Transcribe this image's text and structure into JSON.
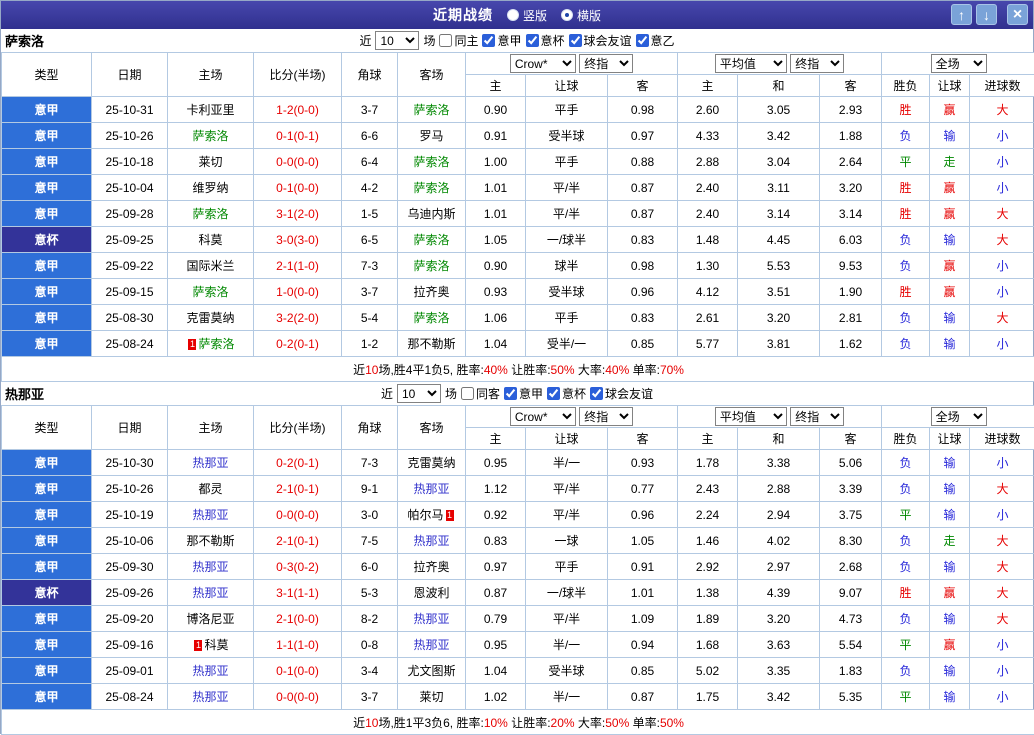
{
  "colors": {
    "titlebar_from": "#4747ad",
    "titlebar_to": "#30308e",
    "button_bg": "#7aa3d8",
    "grid_line": "#b3c9e2",
    "league_bg": "#2e6fd8",
    "cup_bg": "#333399",
    "score_red": "#e60000",
    "result_red": "#e60000",
    "result_green": "#008800",
    "result_blue": "#2626d9"
  },
  "titlebar": {
    "title": "近期战绩",
    "layout_options": [
      {
        "label": "竖版",
        "selected": false
      },
      {
        "label": "横版",
        "selected": true
      }
    ],
    "buttons": {
      "up": "↑",
      "down": "↓",
      "close": "×"
    }
  },
  "table": {
    "columns": [
      "类型",
      "日期",
      "主场",
      "比分(半场)",
      "角球",
      "客场",
      "主",
      "让球",
      "客",
      "主",
      "和",
      "客",
      "胜负",
      "让球",
      "进球数"
    ],
    "selects": {
      "odds_source": "Crow*",
      "final1": "终指",
      "average": "平均值",
      "final2": "终指",
      "full": "全场"
    }
  },
  "sections": [
    {
      "team": "萨索洛",
      "focus_color": "#008800",
      "filter": {
        "near": "近",
        "count": "10",
        "games": "场",
        "same": {
          "label": "同主",
          "checked": false
        },
        "leagues": [
          {
            "label": "意甲",
            "checked": true
          },
          {
            "label": "意杯",
            "checked": true
          },
          {
            "label": "球会友谊",
            "checked": true
          },
          {
            "label": "意乙",
            "checked": true
          }
        ]
      },
      "rows": [
        {
          "type": "意甲",
          "cup": false,
          "date": "25-10-31",
          "home": "卡利亚里",
          "home_focus": false,
          "home_card": null,
          "score": "1-2(0-0)",
          "corner": "3-7",
          "away": "萨索洛",
          "away_focus": true,
          "away_card": null,
          "odds": [
            "0.90",
            "平手",
            "0.98"
          ],
          "avg": [
            "2.60",
            "3.05",
            "2.93"
          ],
          "result": [
            "胜",
            "赢",
            "大"
          ]
        },
        {
          "type": "意甲",
          "cup": false,
          "date": "25-10-26",
          "home": "萨索洛",
          "home_focus": true,
          "home_card": null,
          "score": "0-1(0-1)",
          "corner": "6-6",
          "away": "罗马",
          "away_focus": false,
          "away_card": null,
          "odds": [
            "0.91",
            "受半球",
            "0.97"
          ],
          "avg": [
            "4.33",
            "3.42",
            "1.88"
          ],
          "result": [
            "负",
            "输",
            "小"
          ]
        },
        {
          "type": "意甲",
          "cup": false,
          "date": "25-10-18",
          "home": "莱切",
          "home_focus": false,
          "home_card": null,
          "score": "0-0(0-0)",
          "corner": "6-4",
          "away": "萨索洛",
          "away_focus": true,
          "away_card": null,
          "odds": [
            "1.00",
            "平手",
            "0.88"
          ],
          "avg": [
            "2.88",
            "3.04",
            "2.64"
          ],
          "result": [
            "平",
            "走",
            "小"
          ]
        },
        {
          "type": "意甲",
          "cup": false,
          "date": "25-10-04",
          "home": "维罗纳",
          "home_focus": false,
          "home_card": null,
          "score": "0-1(0-0)",
          "corner": "4-2",
          "away": "萨索洛",
          "away_focus": true,
          "away_card": null,
          "odds": [
            "1.01",
            "平/半",
            "0.87"
          ],
          "avg": [
            "2.40",
            "3.11",
            "3.20"
          ],
          "result": [
            "胜",
            "赢",
            "小"
          ]
        },
        {
          "type": "意甲",
          "cup": false,
          "date": "25-09-28",
          "home": "萨索洛",
          "home_focus": true,
          "home_card": null,
          "score": "3-1(2-0)",
          "corner": "1-5",
          "away": "乌迪内斯",
          "away_focus": false,
          "away_card": null,
          "odds": [
            "1.01",
            "平/半",
            "0.87"
          ],
          "avg": [
            "2.40",
            "3.14",
            "3.14"
          ],
          "result": [
            "胜",
            "赢",
            "大"
          ]
        },
        {
          "type": "意杯",
          "cup": true,
          "date": "25-09-25",
          "home": "科莫",
          "home_focus": false,
          "home_card": null,
          "score": "3-0(3-0)",
          "corner": "6-5",
          "away": "萨索洛",
          "away_focus": true,
          "away_card": null,
          "odds": [
            "1.05",
            "一/球半",
            "0.83"
          ],
          "avg": [
            "1.48",
            "4.45",
            "6.03"
          ],
          "result": [
            "负",
            "输",
            "大"
          ]
        },
        {
          "type": "意甲",
          "cup": false,
          "date": "25-09-22",
          "home": "国际米兰",
          "home_focus": false,
          "home_card": null,
          "score": "2-1(1-0)",
          "corner": "7-3",
          "away": "萨索洛",
          "away_focus": true,
          "away_card": null,
          "odds": [
            "0.90",
            "球半",
            "0.98"
          ],
          "avg": [
            "1.30",
            "5.53",
            "9.53"
          ],
          "result": [
            "负",
            "赢",
            "小"
          ]
        },
        {
          "type": "意甲",
          "cup": false,
          "date": "25-09-15",
          "home": "萨索洛",
          "home_focus": true,
          "home_card": null,
          "score": "1-0(0-0)",
          "corner": "3-7",
          "away": "拉齐奥",
          "away_focus": false,
          "away_card": null,
          "odds": [
            "0.93",
            "受半球",
            "0.96"
          ],
          "avg": [
            "4.12",
            "3.51",
            "1.90"
          ],
          "result": [
            "胜",
            "赢",
            "小"
          ]
        },
        {
          "type": "意甲",
          "cup": false,
          "date": "25-08-30",
          "home": "克雷莫纳",
          "home_focus": false,
          "home_card": null,
          "score": "3-2(2-0)",
          "corner": "5-4",
          "away": "萨索洛",
          "away_focus": true,
          "away_card": null,
          "odds": [
            "1.06",
            "平手",
            "0.83"
          ],
          "avg": [
            "2.61",
            "3.20",
            "2.81"
          ],
          "result": [
            "负",
            "输",
            "大"
          ]
        },
        {
          "type": "意甲",
          "cup": false,
          "date": "25-08-24",
          "home": "萨索洛",
          "home_focus": true,
          "home_card": {
            "text": "1",
            "side": "left"
          },
          "score": "0-2(0-1)",
          "corner": "1-2",
          "away": "那不勒斯",
          "away_focus": false,
          "away_card": null,
          "odds": [
            "1.04",
            "受半/一",
            "0.85"
          ],
          "avg": [
            "5.77",
            "3.81",
            "1.62"
          ],
          "result": [
            "负",
            "输",
            "小"
          ]
        }
      ],
      "summary": [
        {
          "text": "近",
          "red": false
        },
        {
          "text": "10",
          "red": true
        },
        {
          "text": "场,胜4平1负5, ",
          "red": false
        },
        {
          "text": "胜率:",
          "red": false
        },
        {
          "text": "40%",
          "red": true
        },
        {
          "text": " 让胜率:",
          "red": false
        },
        {
          "text": "50%",
          "red": true
        },
        {
          "text": " 大率:",
          "red": false
        },
        {
          "text": "40%",
          "red": true
        },
        {
          "text": " 单率:",
          "red": false
        },
        {
          "text": "70%",
          "red": true
        }
      ]
    },
    {
      "team": "热那亚",
      "focus_color": "#3333cc",
      "filter": {
        "near": "近",
        "count": "10",
        "games": "场",
        "same": {
          "label": "同客",
          "checked": false
        },
        "leagues": [
          {
            "label": "意甲",
            "checked": true
          },
          {
            "label": "意杯",
            "checked": true
          },
          {
            "label": "球会友谊",
            "checked": true
          }
        ]
      },
      "rows": [
        {
          "type": "意甲",
          "cup": false,
          "date": "25-10-30",
          "home": "热那亚",
          "home_focus": true,
          "home_card": null,
          "score": "0-2(0-1)",
          "corner": "7-3",
          "away": "克雷莫纳",
          "away_focus": false,
          "away_card": null,
          "odds": [
            "0.95",
            "半/一",
            "0.93"
          ],
          "avg": [
            "1.78",
            "3.38",
            "5.06"
          ],
          "result": [
            "负",
            "输",
            "小"
          ]
        },
        {
          "type": "意甲",
          "cup": false,
          "date": "25-10-26",
          "home": "都灵",
          "home_focus": false,
          "home_card": null,
          "score": "2-1(0-1)",
          "corner": "9-1",
          "away": "热那亚",
          "away_focus": true,
          "away_card": null,
          "odds": [
            "1.12",
            "平/半",
            "0.77"
          ],
          "avg": [
            "2.43",
            "2.88",
            "3.39"
          ],
          "result": [
            "负",
            "输",
            "大"
          ]
        },
        {
          "type": "意甲",
          "cup": false,
          "date": "25-10-19",
          "home": "热那亚",
          "home_focus": true,
          "home_card": null,
          "score": "0-0(0-0)",
          "corner": "3-0",
          "away": "帕尔马",
          "away_focus": false,
          "away_card": {
            "text": "1",
            "side": "right"
          },
          "odds": [
            "0.92",
            "平/半",
            "0.96"
          ],
          "avg": [
            "2.24",
            "2.94",
            "3.75"
          ],
          "result": [
            "平",
            "输",
            "小"
          ]
        },
        {
          "type": "意甲",
          "cup": false,
          "date": "25-10-06",
          "home": "那不勒斯",
          "home_focus": false,
          "home_card": null,
          "score": "2-1(0-1)",
          "corner": "7-5",
          "away": "热那亚",
          "away_focus": true,
          "away_card": null,
          "odds": [
            "0.83",
            "一球",
            "1.05"
          ],
          "avg": [
            "1.46",
            "4.02",
            "8.30"
          ],
          "result": [
            "负",
            "走",
            "大"
          ]
        },
        {
          "type": "意甲",
          "cup": false,
          "date": "25-09-30",
          "home": "热那亚",
          "home_focus": true,
          "home_card": null,
          "score": "0-3(0-2)",
          "corner": "6-0",
          "away": "拉齐奥",
          "away_focus": false,
          "away_card": null,
          "odds": [
            "0.97",
            "平手",
            "0.91"
          ],
          "avg": [
            "2.92",
            "2.97",
            "2.68"
          ],
          "result": [
            "负",
            "输",
            "大"
          ]
        },
        {
          "type": "意杯",
          "cup": true,
          "date": "25-09-26",
          "home": "热那亚",
          "home_focus": true,
          "home_card": null,
          "score": "3-1(1-1)",
          "corner": "5-3",
          "away": "恩波利",
          "away_focus": false,
          "away_card": null,
          "odds": [
            "0.87",
            "一/球半",
            "1.01"
          ],
          "avg": [
            "1.38",
            "4.39",
            "9.07"
          ],
          "result": [
            "胜",
            "赢",
            "大"
          ]
        },
        {
          "type": "意甲",
          "cup": false,
          "date": "25-09-20",
          "home": "博洛尼亚",
          "home_focus": false,
          "home_card": null,
          "score": "2-1(0-0)",
          "corner": "8-2",
          "away": "热那亚",
          "away_focus": true,
          "away_card": null,
          "odds": [
            "0.79",
            "平/半",
            "1.09"
          ],
          "avg": [
            "1.89",
            "3.20",
            "4.73"
          ],
          "result": [
            "负",
            "输",
            "大"
          ]
        },
        {
          "type": "意甲",
          "cup": false,
          "date": "25-09-16",
          "home": "科莫",
          "home_focus": false,
          "home_card": {
            "text": "1",
            "side": "left"
          },
          "score": "1-1(1-0)",
          "corner": "0-8",
          "away": "热那亚",
          "away_focus": true,
          "away_card": null,
          "odds": [
            "0.95",
            "半/一",
            "0.94"
          ],
          "avg": [
            "1.68",
            "3.63",
            "5.54"
          ],
          "result": [
            "平",
            "赢",
            "小"
          ]
        },
        {
          "type": "意甲",
          "cup": false,
          "date": "25-09-01",
          "home": "热那亚",
          "home_focus": true,
          "home_card": null,
          "score": "0-1(0-0)",
          "corner": "3-4",
          "away": "尤文图斯",
          "away_focus": false,
          "away_card": null,
          "odds": [
            "1.04",
            "受半球",
            "0.85"
          ],
          "avg": [
            "5.02",
            "3.35",
            "1.83"
          ],
          "result": [
            "负",
            "输",
            "小"
          ]
        },
        {
          "type": "意甲",
          "cup": false,
          "date": "25-08-24",
          "home": "热那亚",
          "home_focus": true,
          "home_card": null,
          "score": "0-0(0-0)",
          "corner": "3-7",
          "away": "莱切",
          "away_focus": false,
          "away_card": null,
          "odds": [
            "1.02",
            "半/一",
            "0.87"
          ],
          "avg": [
            "1.75",
            "3.42",
            "5.35"
          ],
          "result": [
            "平",
            "输",
            "小"
          ]
        }
      ],
      "summary": [
        {
          "text": "近",
          "red": false
        },
        {
          "text": "10",
          "red": true
        },
        {
          "text": "场,胜1平3负6, ",
          "red": false
        },
        {
          "text": "胜率:",
          "red": false
        },
        {
          "text": "10%",
          "red": true
        },
        {
          "text": " 让胜率:",
          "red": false
        },
        {
          "text": "20%",
          "red": true
        },
        {
          "text": " 大率:",
          "red": false
        },
        {
          "text": "50%",
          "red": true
        },
        {
          "text": " 单率:",
          "red": false
        },
        {
          "text": "50%",
          "red": true
        }
      ]
    }
  ]
}
